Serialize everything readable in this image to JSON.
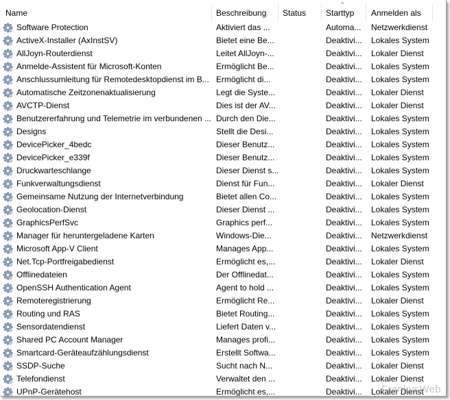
{
  "columns": {
    "name": "Name",
    "description": "Beschreibung",
    "status": "Status",
    "startup_type": "Starttyp",
    "logon_as": "Anmelden als"
  },
  "sort_indicator": "^",
  "services": [
    {
      "name": "Software Protection",
      "description": "Aktiviert das ...",
      "status": "",
      "startup_type": "Automa...",
      "logon_as": "Netzwerkdienst"
    },
    {
      "name": "ActiveX-Installer (AxInstSV)",
      "description": "Bietet eine Be...",
      "status": "",
      "startup_type": "Deaktivi...",
      "logon_as": "Lokales System"
    },
    {
      "name": "AllJoyn-Routerdienst",
      "description": "Leitet AllJoyn-...",
      "status": "",
      "startup_type": "Deaktivi...",
      "logon_as": "Lokaler Dienst"
    },
    {
      "name": "Anmelde-Assistent für Microsoft-Konten",
      "description": "Ermöglicht Be...",
      "status": "",
      "startup_type": "Deaktivi...",
      "logon_as": "Lokales System"
    },
    {
      "name": "Anschlussumleitung für Remotedesktopdienst im B...",
      "description": "Ermöglicht di...",
      "status": "",
      "startup_type": "Deaktivi...",
      "logon_as": "Lokales System"
    },
    {
      "name": "Automatische Zeitzonenaktualisierung",
      "description": "Legt die Syste...",
      "status": "",
      "startup_type": "Deaktivi...",
      "logon_as": "Lokaler Dienst"
    },
    {
      "name": "AVCTP-Dienst",
      "description": "Dies ist der AV...",
      "status": "",
      "startup_type": "Deaktivi...",
      "logon_as": "Lokaler Dienst"
    },
    {
      "name": "Benutzererfahrung und Telemetrie im verbundenen ...",
      "description": "Durch den Die...",
      "status": "",
      "startup_type": "Deaktivi...",
      "logon_as": "Lokales System"
    },
    {
      "name": "Designs",
      "description": "Stellt die Desi...",
      "status": "",
      "startup_type": "Deaktivi...",
      "logon_as": "Lokales System"
    },
    {
      "name": "DevicePicker_4bedc",
      "description": "Dieser Benutz...",
      "status": "",
      "startup_type": "Deaktivi...",
      "logon_as": "Lokales System"
    },
    {
      "name": "DevicePicker_e339f",
      "description": "Dieser Benutz...",
      "status": "",
      "startup_type": "Deaktivi...",
      "logon_as": "Lokales System"
    },
    {
      "name": "Druckwarteschlange",
      "description": "Dieser Dienst s...",
      "status": "",
      "startup_type": "Deaktivi...",
      "logon_as": "Lokales System"
    },
    {
      "name": "Funkverwaltungsdienst",
      "description": "Dienst für Fun...",
      "status": "",
      "startup_type": "Deaktivi...",
      "logon_as": "Lokaler Dienst"
    },
    {
      "name": "Gemeinsame Nutzung der Internetverbindung",
      "description": "Bietet allen Co...",
      "status": "",
      "startup_type": "Deaktivi...",
      "logon_as": "Lokales System"
    },
    {
      "name": "Geolocation-Dienst",
      "description": "Dieser Dienst ...",
      "status": "",
      "startup_type": "Deaktivi...",
      "logon_as": "Lokales System"
    },
    {
      "name": "GraphicsPerfSvc",
      "description": "Graphics perf...",
      "status": "",
      "startup_type": "Deaktivi...",
      "logon_as": "Lokales System"
    },
    {
      "name": "Manager für heruntergeladene Karten",
      "description": "Windows-Die...",
      "status": "",
      "startup_type": "Deaktivi...",
      "logon_as": "Netzwerkdienst"
    },
    {
      "name": "Microsoft App-V Client",
      "description": "Manages App...",
      "status": "",
      "startup_type": "Deaktivi...",
      "logon_as": "Lokales System"
    },
    {
      "name": "Net.Tcp-Portfreigabedienst",
      "description": "Ermöglicht es,...",
      "status": "",
      "startup_type": "Deaktivi...",
      "logon_as": "Lokaler Dienst"
    },
    {
      "name": "Offlinedateien",
      "description": "Der Offlinedat...",
      "status": "",
      "startup_type": "Deaktivi...",
      "logon_as": "Lokales System"
    },
    {
      "name": "OpenSSH Authentication Agent",
      "description": "Agent to hold ...",
      "status": "",
      "startup_type": "Deaktivi...",
      "logon_as": "Lokales System"
    },
    {
      "name": "Remoteregistrierung",
      "description": "Ermöglicht Re...",
      "status": "",
      "startup_type": "Deaktivi...",
      "logon_as": "Lokaler Dienst"
    },
    {
      "name": "Routing und RAS",
      "description": "Bietet Routing...",
      "status": "",
      "startup_type": "Deaktivi...",
      "logon_as": "Lokales System"
    },
    {
      "name": "Sensordatendienst",
      "description": "Liefert Daten v...",
      "status": "",
      "startup_type": "Deaktivi...",
      "logon_as": "Lokales System"
    },
    {
      "name": "Shared PC Account Manager",
      "description": "Manages profi...",
      "status": "",
      "startup_type": "Deaktivi...",
      "logon_as": "Lokales System"
    },
    {
      "name": "Smartcard-Geräteaufzählungsdienst",
      "description": "Erstellt Softwa...",
      "status": "",
      "startup_type": "Deaktivi...",
      "logon_as": "Lokales System"
    },
    {
      "name": "SSDP-Suche",
      "description": "Sucht nach N...",
      "status": "",
      "startup_type": "Deaktivi...",
      "logon_as": "Lokaler Dienst"
    },
    {
      "name": "Telefondienst",
      "description": "Verwaltet den ...",
      "status": "",
      "startup_type": "Deaktivi...",
      "logon_as": "Lokaler Dienst"
    },
    {
      "name": "UPnP-Gerätehost",
      "description": "Ermöglicht es,...",
      "status": "",
      "startup_type": "Deaktivi...",
      "logon_as": "Lokaler Dienst"
    }
  ],
  "row_icon": "gear-service-icon",
  "watermark": "FrankysWeb"
}
